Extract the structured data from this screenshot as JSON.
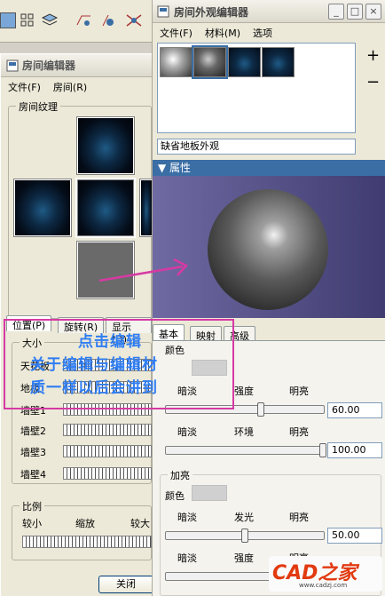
{
  "left_window": {
    "title": "房间编辑器",
    "menu": [
      "文件(F)",
      "房间(R)"
    ],
    "textures_group": "房间纹理",
    "tabs": [
      "位置(P)",
      "旋转(R)",
      "显示(D)"
    ],
    "size_group": "大小",
    "rows": [
      "天花板",
      "地板",
      "墙壁1",
      "墙壁2",
      "墙壁3",
      "墙壁4"
    ],
    "scale_group": "比例",
    "scale_labels": [
      "较小",
      "缩放",
      "较大"
    ],
    "close_button": "关闭"
  },
  "right_window": {
    "title": "房间外观编辑器",
    "menu": [
      "文件(F)",
      "材料(M)",
      "选项"
    ],
    "add_button": "+",
    "remove_button": "−",
    "material_name": "缺省地板外观",
    "properties_header": "属性",
    "tabs": [
      "基本",
      "映射",
      "高级"
    ],
    "color_label": "颜色",
    "brightness": {
      "dim": "暗淡",
      "strength": "强度",
      "bright": "明亮",
      "value": "60.00",
      "level": 0.5
    },
    "ambient": {
      "dim": "暗淡",
      "ambient": "环境",
      "bright": "明亮",
      "value": "100.00",
      "level": 1.0
    },
    "highlight_group": "加亮",
    "highlight_color": "颜色",
    "glow": {
      "dim": "暗淡",
      "glow": "发光",
      "bright": "明亮",
      "value": "50.00",
      "level": 0.5
    },
    "strength2": {
      "dim": "暗淡",
      "strength": "强度",
      "bright": "明亮"
    }
  },
  "annotation": {
    "line1": "点击编辑",
    "line2": "关于编辑与编辑材",
    "line3": "质一样以后会讲到",
    "color": "#2f7df2",
    "box_color": "#d63aa3"
  },
  "watermark": {
    "brand": "CAD之家",
    "url": "www.cadzj.com"
  }
}
